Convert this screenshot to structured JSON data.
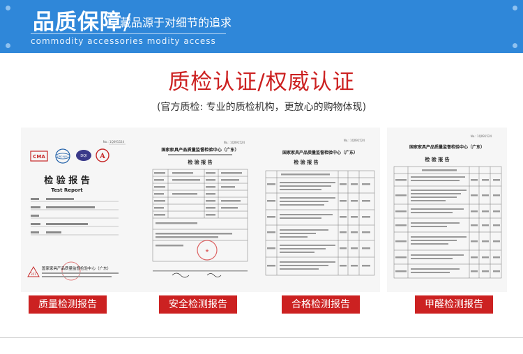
{
  "banner": {
    "title": "品质保障",
    "slash": "/",
    "subtitle": "藏品源于对细节的追求",
    "english": "commodity accessories modity access",
    "color": "#2f87d9"
  },
  "section": {
    "heading": "质检认证/权威认证",
    "subheading": "(官方质检: 专业的质检机构，更放心的购物体现)",
    "accent": "#cc2121"
  },
  "documents": [
    {
      "label": "质量检测报告",
      "no": "No.: 1Q091524",
      "title": "检 验 报 告",
      "title_en": "Test Report",
      "logos": [
        "CMA",
        "DRC·NSU",
        "DQI",
        "A"
      ],
      "org_footer": "国家家具产品质量监督检验中心（广东）"
    },
    {
      "label": "安全检测报告",
      "no": "No.: 1Q091524",
      "org": "国家家具产品质量监督检验中心（广东）",
      "title": "检 验 报 告"
    },
    {
      "label": "合格检测报告",
      "no": "No.: 1Q091524",
      "org": "国家家具产品质量监督检验中心（广东）",
      "title": "检 验 报 告"
    },
    {
      "label": "甲醛检测报告",
      "no": "No.: 1Q091524",
      "org": "国家家具产品质量监督检验中心（广东）",
      "title": "检 验 报 告"
    }
  ]
}
